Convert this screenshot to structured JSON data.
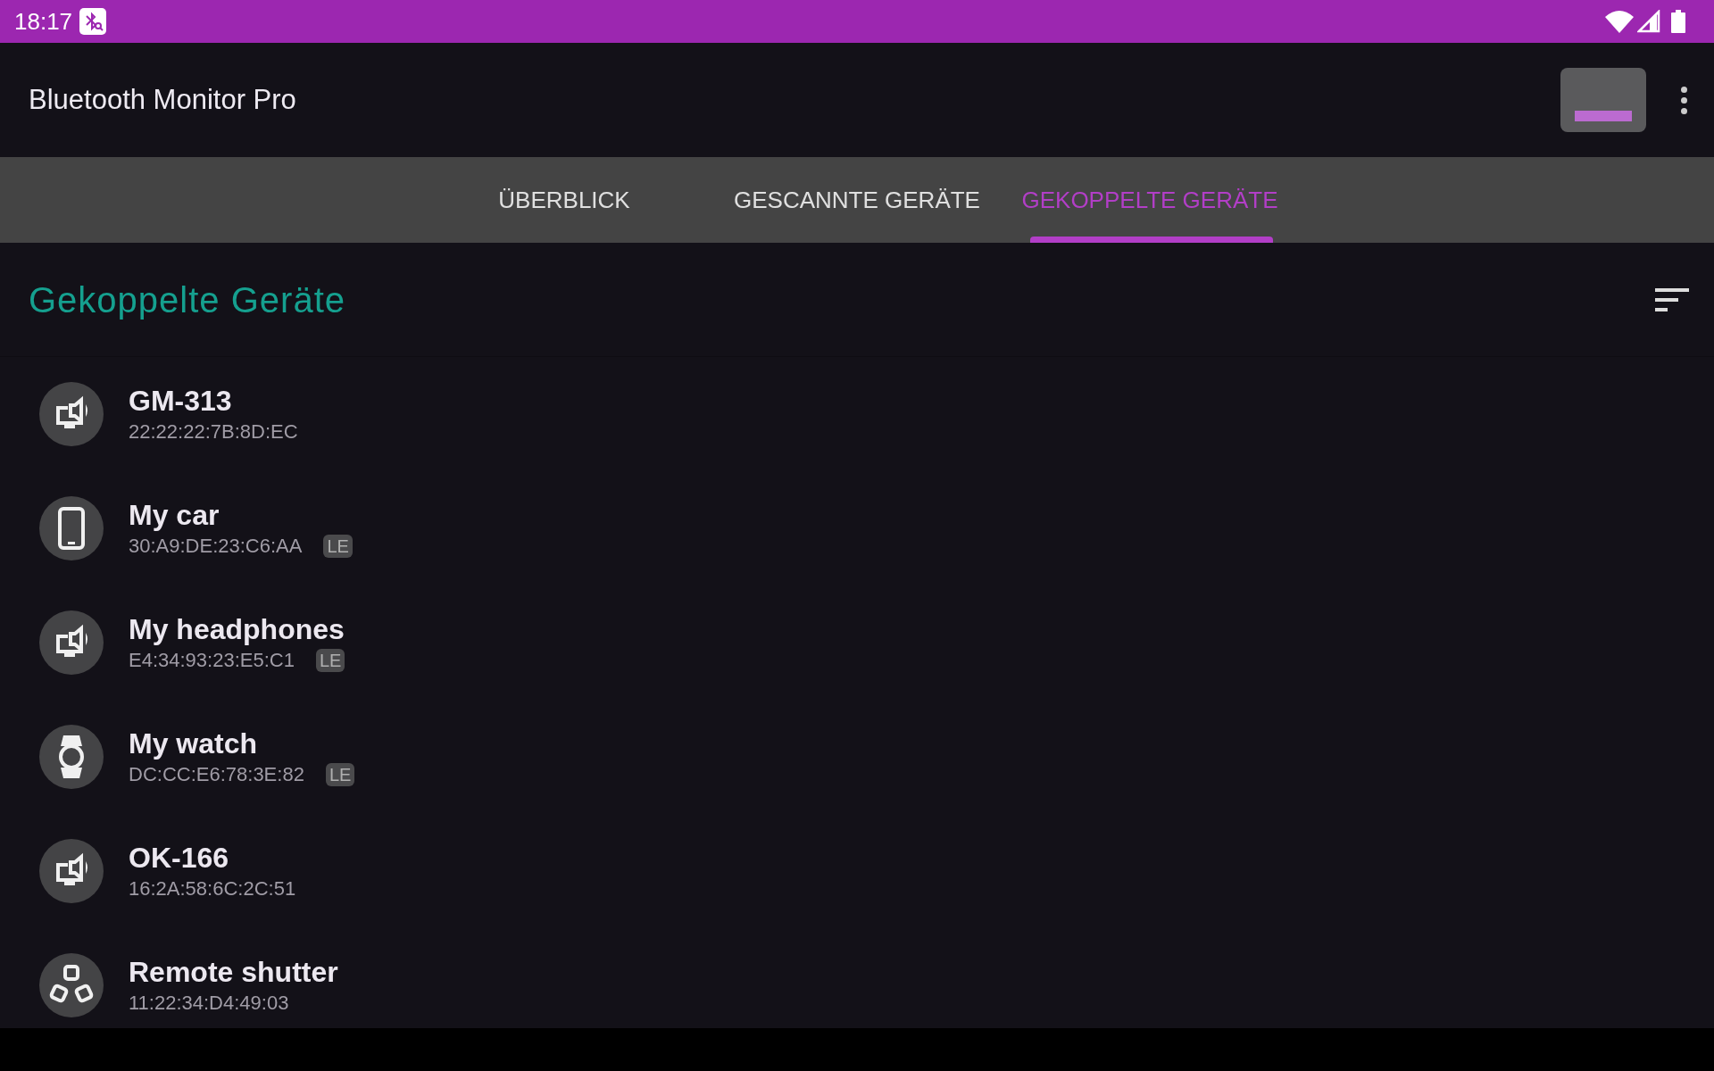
{
  "status_bar": {
    "time": "18:17"
  },
  "app_bar": {
    "title": "Bluetooth Monitor Pro"
  },
  "tabs": [
    {
      "label": "ÜBERBLICK",
      "selected": false
    },
    {
      "label": "GESCANNTE GERÄTE",
      "selected": false
    },
    {
      "label": "GEKOPPELTE GERÄTE",
      "selected": true
    }
  ],
  "section": {
    "title": "Gekoppelte Geräte"
  },
  "devices": [
    {
      "kind": "speaker",
      "name": "GM-313",
      "address": "22:22:22:7B:8D:EC"
    },
    {
      "kind": "phone",
      "name": "My car",
      "address": "30:A9:DE:23:C6:AA",
      "badge": "LE"
    },
    {
      "kind": "speaker",
      "name": "My headphones",
      "address": "E4:34:93:23:E5:C1",
      "badge": "LE"
    },
    {
      "kind": "watch",
      "name": "My watch",
      "address": "DC:CC:E6:78:3E:82",
      "badge": "LE"
    },
    {
      "kind": "speaker",
      "name": "OK-166",
      "address": "16:2A:58:6C:2C:51"
    },
    {
      "kind": "group",
      "name": "Remote shutter",
      "address": "11:22:34:D4:49:03"
    }
  ]
}
